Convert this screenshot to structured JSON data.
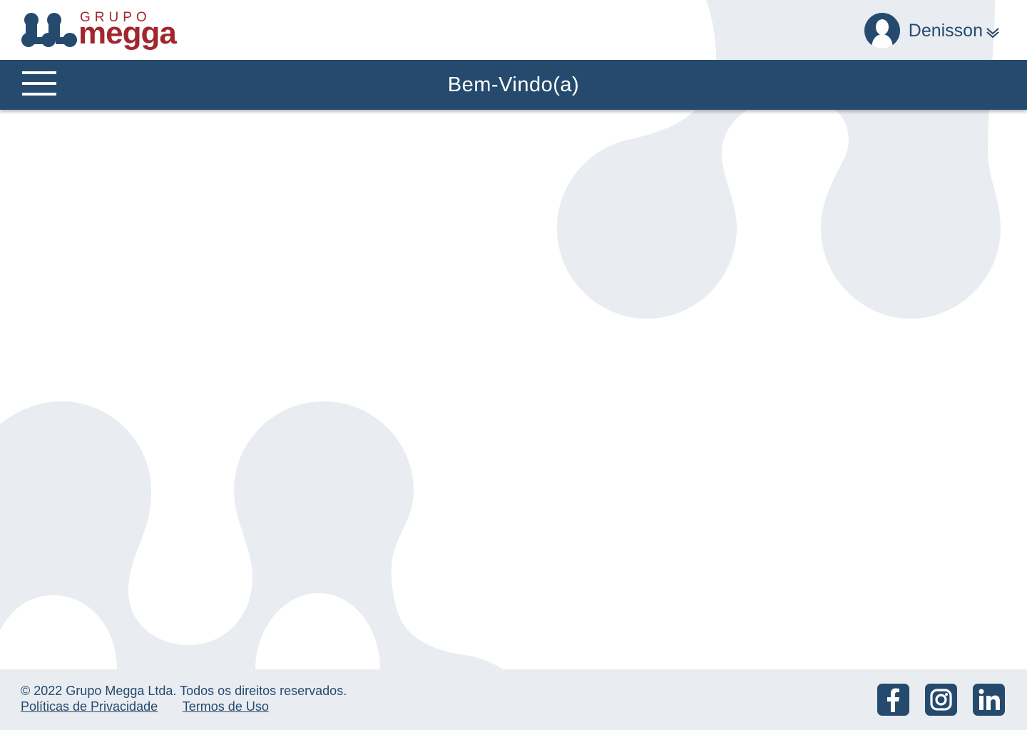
{
  "brand": {
    "logo_top": "GRUPO",
    "logo_main": "megga",
    "primary_color": "#264a6e",
    "accent_color": "#a2262e",
    "background_shape_color": "#e9ecf1"
  },
  "header": {
    "user_name": "Denisson",
    "avatar_icon": "user-silhouette-icon",
    "dropdown_icon": "double-chevron-down-icon"
  },
  "topbar": {
    "title": "Bem-Vindo(a)",
    "menu_icon": "hamburger-menu-icon"
  },
  "footer": {
    "copyright": "© 2022 Grupo Megga Ltda. Todos os direitos reservados.",
    "links": [
      {
        "label": "Políticas de Privacidade"
      },
      {
        "label": "Termos de Uso"
      }
    ],
    "social": [
      {
        "icon": "facebook-icon"
      },
      {
        "icon": "instagram-icon"
      },
      {
        "icon": "linkedin-icon"
      }
    ]
  }
}
